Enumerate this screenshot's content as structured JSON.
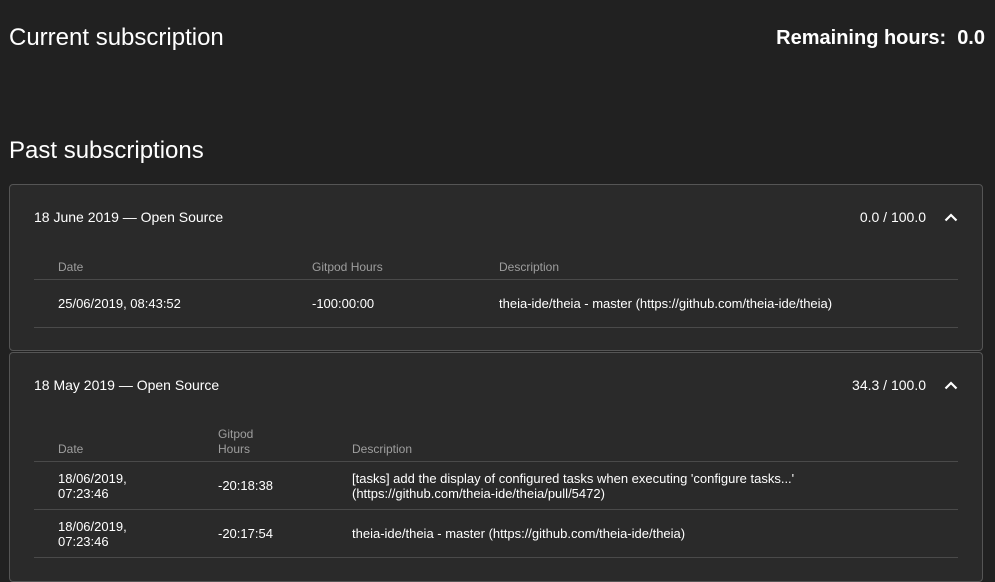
{
  "current": {
    "title": "Current subscription",
    "remaining_label": "Remaining hours:",
    "remaining_value": "0.0"
  },
  "past": {
    "title": "Past subscriptions",
    "subscriptions": [
      {
        "title": "18 June 2019 — Open Source",
        "usage": "0.0 / 100.0",
        "columns": [
          "Date",
          "Gitpod Hours",
          "Description"
        ],
        "rows": [
          {
            "date": "25/06/2019, 08:43:52",
            "hours": "-100:00:00",
            "description": "theia-ide/theia - master (https://github.com/theia-ide/theia)"
          }
        ]
      },
      {
        "title": "18 May 2019 — Open Source",
        "usage": "34.3 / 100.0",
        "columns": [
          "Date",
          "Gitpod Hours",
          "Description"
        ],
        "rows": [
          {
            "date": "18/06/2019, 07:23:46",
            "hours": "-20:18:38",
            "description": "[tasks] add the display of configured tasks when executing 'configure tasks...' (https://github.com/theia-ide/theia/pull/5472)"
          },
          {
            "date": "18/06/2019, 07:23:46",
            "hours": "-20:17:54",
            "description": "theia-ide/theia - master (https://github.com/theia-ide/theia)"
          }
        ]
      }
    ]
  },
  "icons": {
    "collapse": "chevron-up-icon"
  }
}
